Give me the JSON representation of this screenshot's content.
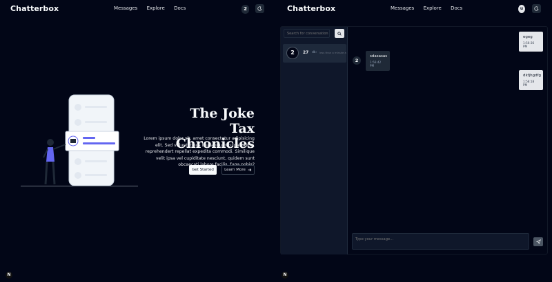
{
  "left": {
    "brand": "Chatterbox",
    "nav": [
      "Messages",
      "Explore",
      "Docs"
    ],
    "badge": "2",
    "hero": {
      "title_line1": "The Joke Tax",
      "title_line2": "Chronicles",
      "description": "Lorem ipsum dolor sit, amet consectetur adipisicing elit. Sed voluptatibus laudantium culpa saepe, reprehendert repellat expedita commodi. Similique velit ipsa vel cupiditate nesciunt, quidem sunt obcaecati labore facilis, fuga nobis?",
      "primary_button": "Get Started",
      "secondary_button": "Learn More",
      "secondary_icon": "arrow-right-icon"
    },
    "footer_logo": "N"
  },
  "right": {
    "brand": "Chatterbox",
    "nav": [
      "Messages",
      "Explore",
      "Docs"
    ],
    "user_avatar": "u",
    "search": {
      "placeholder": "Search for conversation"
    },
    "conversation": {
      "avatar": "2",
      "name": "27",
      "preview": "dk:",
      "time": "less than a minute ago"
    },
    "messages": [
      {
        "text": "egeg",
        "time": "1:56:36 PM",
        "side": "right"
      },
      {
        "text": "sdasasas",
        "time": "1:56:42 PM",
        "side": "left",
        "avatar": "2"
      },
      {
        "text": "dkfjhgdfg",
        "time": "1:58:18 PM",
        "side": "right"
      }
    ],
    "composer": {
      "placeholder": "Type your message..."
    },
    "footer_logo": "N"
  },
  "colors": {
    "background": "#020617",
    "accent": "#6366f1",
    "bubble_dark": "#1f2937",
    "bubble_light": "#e5e7eb"
  }
}
